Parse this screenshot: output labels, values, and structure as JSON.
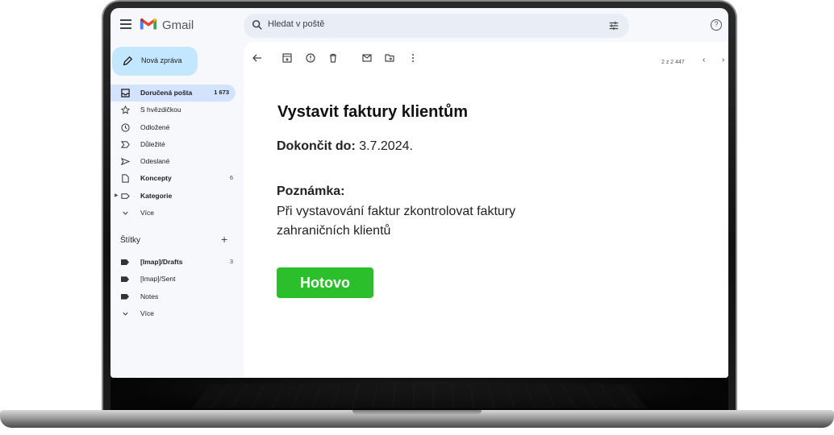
{
  "app": {
    "brand": "Gmail"
  },
  "search": {
    "placeholder": "Hledat v poště"
  },
  "compose": {
    "label": "Nová zpráva"
  },
  "sidebar": {
    "items": [
      {
        "label": "Doručená pošta",
        "count": "1 673",
        "icon": "inbox-icon"
      },
      {
        "label": "S hvězdičkou",
        "count": "",
        "icon": "star-icon"
      },
      {
        "label": "Odložené",
        "count": "",
        "icon": "clock-icon"
      },
      {
        "label": "Důležité",
        "count": "",
        "icon": "important-icon"
      },
      {
        "label": "Odeslané",
        "count": "",
        "icon": "send-icon"
      },
      {
        "label": "Koncepty",
        "count": "6",
        "icon": "draft-icon"
      },
      {
        "label": "Kategorie",
        "count": "",
        "icon": "label-icon"
      },
      {
        "label": "Více",
        "count": "",
        "icon": "chevron-down-icon"
      }
    ],
    "labels_title": "Štítky",
    "labels": [
      {
        "label": "[Imap]/Drafts",
        "count": "3"
      },
      {
        "label": "[Imap]/Sent",
        "count": ""
      },
      {
        "label": "Notes",
        "count": ""
      },
      {
        "label": "Více",
        "count": ""
      }
    ]
  },
  "toolbar": {
    "pager": "2 z 2 447"
  },
  "mail": {
    "subject": "Vystavit faktury klientům",
    "deadline_label": "Dokončit do:",
    "deadline_value": " 3.7.2024.",
    "note_label": "Poznámka:",
    "note_line1": "Při vystavování faktur zkontrolovat faktury",
    "note_line2": "zahraničních klientů",
    "done_button": "Hotovo"
  },
  "colors": {
    "accent_button": "#2bbf2b",
    "compose_bg": "#c2e7ff",
    "active_nav": "#d3e3fd"
  }
}
